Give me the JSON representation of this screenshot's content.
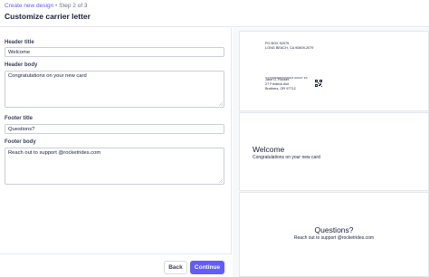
{
  "header": {
    "breadcrumb_link": "Create new design",
    "breadcrumb_separator": "•",
    "breadcrumb_step": "Step 2 of 3",
    "title": "Customize carrier letter"
  },
  "form": {
    "header_title_label": "Header title",
    "header_title_value": "Welcome",
    "header_body_label": "Header body",
    "header_body_value": "Congratulations on your new card",
    "footer_title_label": "Footer title",
    "footer_title_value": "Questions?",
    "footer_body_label": "Footer body",
    "footer_body_value": "Reach out to support @rocketrides.com"
  },
  "buttons": {
    "back": "Back",
    "continue": "Continue"
  },
  "preview": {
    "return_address": [
      "PO BOX 92079",
      "LONG BEACH, CA 90809-2079"
    ],
    "barcode_line": "CSTR000000000023 00037 9X",
    "recipient_address": [
      "Jane D. Rocket",
      "27 Fredrick Ave",
      "Brothers, OR 97712"
    ],
    "header_title": "Welcome",
    "header_body": "Congratulations on your new card",
    "footer_title": "Questions?",
    "footer_body": "Reach out to support @rocketrides.com"
  },
  "colors": {
    "accent": "#635bff",
    "border": "#e3e8ee",
    "preview_background": "#f6f8fa"
  },
  "icons": {
    "qr": "qr-code-icon",
    "resize": "resize-grip-icon"
  }
}
